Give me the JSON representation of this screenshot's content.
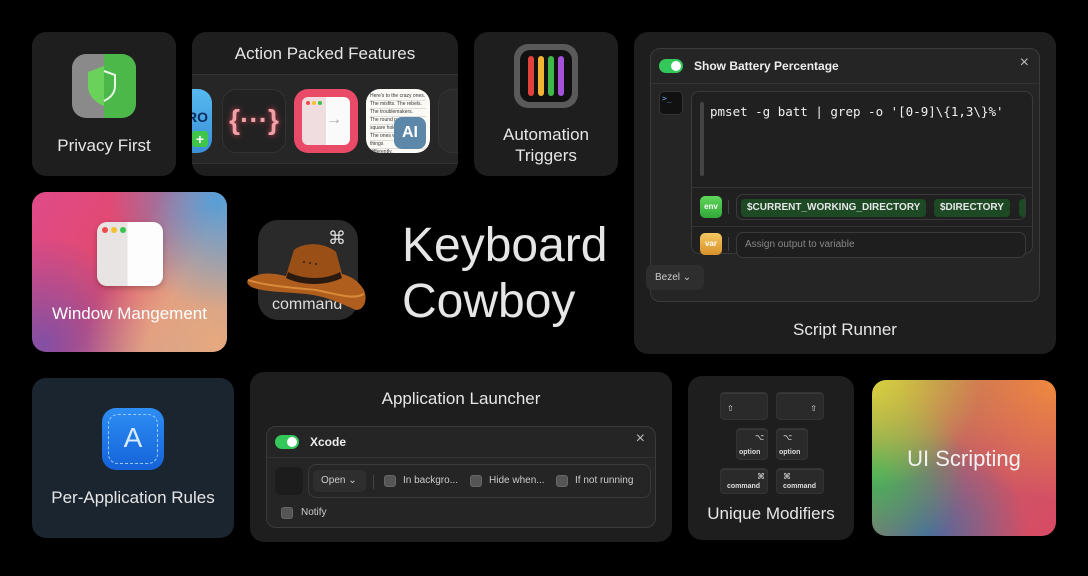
{
  "app": {
    "title_line1": "Keyboard",
    "title_line2": "Cowboy",
    "logo_glyph": "⌘",
    "logo_word": "command"
  },
  "cards": {
    "privacy": {
      "label": "Privacy First",
      "icon": "shield-icon"
    },
    "action": {
      "label": "Action Packed Features",
      "tiles": [
        {
          "name": "ro-app",
          "text": "RO",
          "badge": "+"
        },
        {
          "name": "braces-app",
          "text": "{···}"
        },
        {
          "name": "window-tidy-app",
          "arrow": "→"
        },
        {
          "name": "text-ai-app",
          "lines": [
            "Here's to the crazy ones.",
            "The misfits. The rebels.",
            "The troublemakers.",
            "The round pegs in the",
            "square holes.",
            "The ones who see",
            "things",
            "differently."
          ],
          "badge": "AI"
        },
        {
          "name": "dark-app"
        }
      ]
    },
    "automation": {
      "label_line1": "Automation",
      "label_line2": "Triggers",
      "bar_colors": [
        "#e0413a",
        "#f2b531",
        "#3fb84a",
        "#a552d8"
      ]
    },
    "script": {
      "label": "Script Runner",
      "enabled": true,
      "title": "Show Battery Percentage",
      "close": "×",
      "terminal_glyph": ">_",
      "code": "pmset -g batt | grep -o '[0-9]\\{1,3\\}%'",
      "env_icon": "env",
      "env_chips": [
        "$CURRENT_WORKING_DIRECTORY",
        "$DIRECTORY",
        "$"
      ],
      "var_icon": "var",
      "var_placeholder": "Assign output to variable",
      "notification": "Bezel",
      "chevron": "⌄"
    },
    "window": {
      "label": "Window Mangement"
    },
    "perapp": {
      "label": "Per-Application Rules",
      "icon_glyph": "A"
    },
    "launcher": {
      "label": "Application Launcher",
      "enabled": true,
      "app_name": "Xcode",
      "close": "×",
      "action": "Open",
      "chevron": "⌄",
      "options": [
        {
          "label": "In backgro...",
          "checked": false
        },
        {
          "label": "Hide when...",
          "checked": false
        },
        {
          "label": "If not running",
          "checked": false
        }
      ],
      "notify": {
        "label": "Notify",
        "checked": false
      }
    },
    "modifiers": {
      "label": "Unique Modifiers",
      "keys": [
        {
          "glyph": "⇧",
          "word": ""
        },
        {
          "glyph": "⇧",
          "word": ""
        },
        {
          "glyph": "⌥",
          "word": "option"
        },
        {
          "glyph": "⌥",
          "word": "option"
        },
        {
          "glyph": "⌘",
          "word": "command"
        },
        {
          "glyph": "⌘",
          "word": "command"
        }
      ]
    },
    "uiscript": {
      "label": "UI Scripting"
    }
  },
  "colors": {
    "toggle_on": "#34c759",
    "chip_bg": "#1d4a25",
    "background": "#000000",
    "card": "#1e1e1e"
  }
}
